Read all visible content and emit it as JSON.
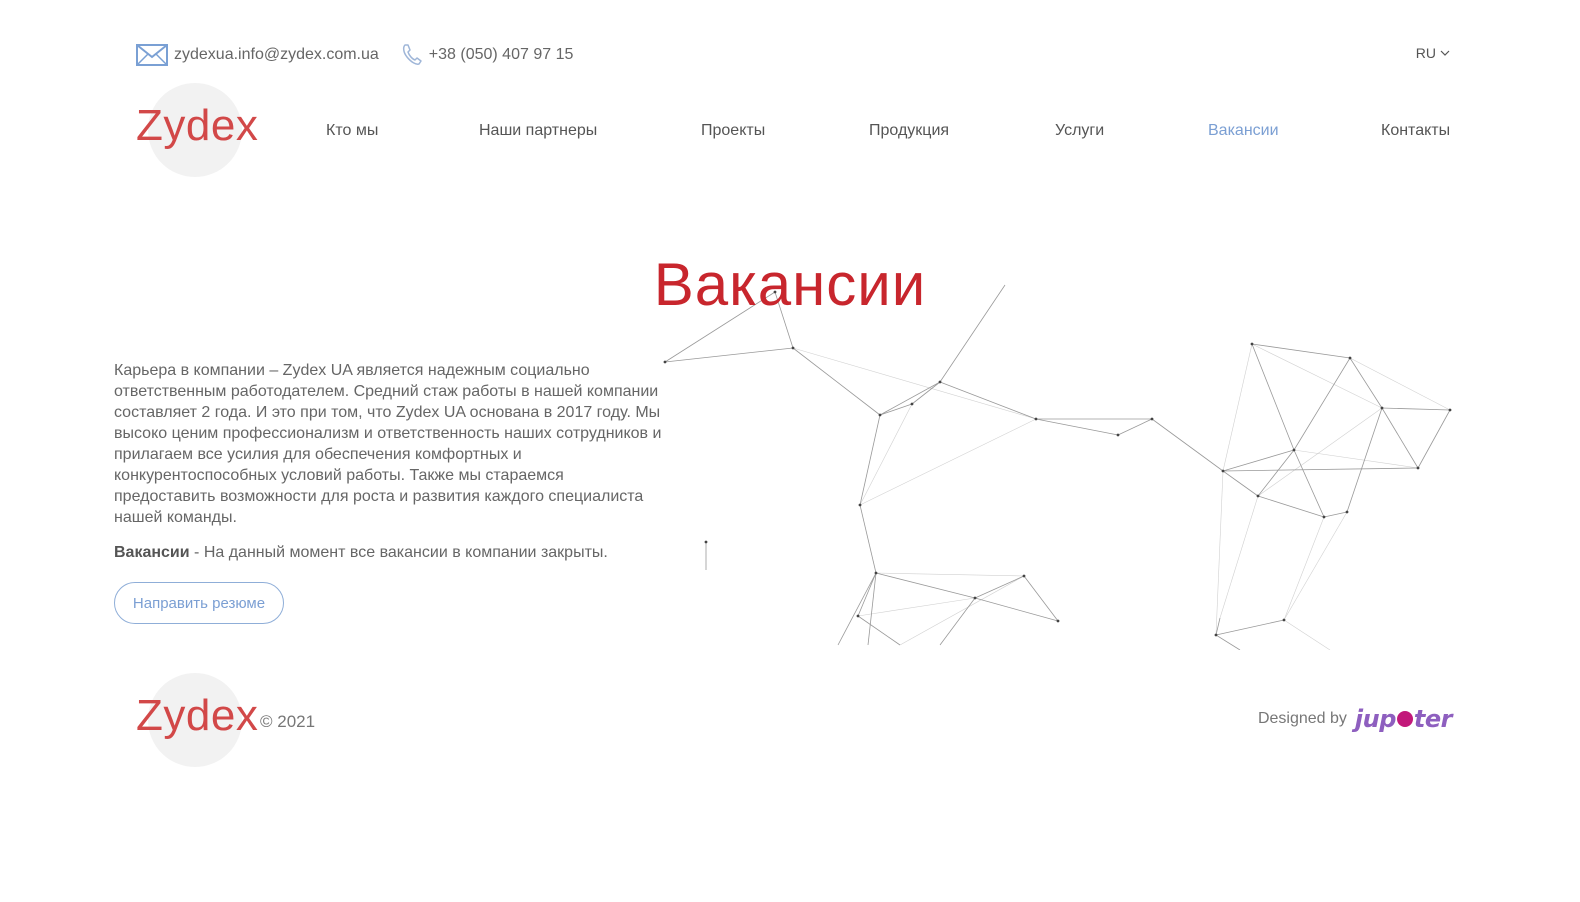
{
  "contacts": {
    "email": "zydexua.info@zydex.com.ua",
    "phone": "+38 (050) 407 97 15"
  },
  "language": {
    "current": "RU"
  },
  "logo": {
    "text": "Zydex"
  },
  "nav": {
    "items": [
      {
        "label": "Кто мы",
        "active": false
      },
      {
        "label": "Наши партнеры",
        "active": false
      },
      {
        "label": "Проекты",
        "active": false
      },
      {
        "label": "Продукция",
        "active": false
      },
      {
        "label": "Услуги",
        "active": false
      },
      {
        "label": "Вакансии",
        "active": true
      },
      {
        "label": "Контакты",
        "active": false
      }
    ]
  },
  "main": {
    "title": "Вакансии",
    "intro": "Карьера в компании – Zydex UA является надежным социально ответственным работодателем. Средний стаж работы в нашей компании составляет 2 года. И это при том, что Zydex UA основана в 2017 году. Мы высоко ценим профессионализм и ответственность наших сотрудников и прилагаем все усилия для обеспечения комфортных и конкурентоспособных условий работы. Также мы стараемся предоставить возможности для роста и развития каждого специалиста нашей команды.",
    "vacancies_label": "Вакансии",
    "vacancies_text": " - На данный момент все вакансии в компании закрыты.",
    "resume_button": "Направить резюме"
  },
  "footer": {
    "copyright": "© 2021",
    "designed_by": "Designed by",
    "designer_logo": {
      "part1": "jup",
      "part2": "ter"
    }
  },
  "colors": {
    "brand_red": "#c8262d",
    "logo_red": "#d24848",
    "accent_blue": "#7b9fd3",
    "text": "#666666",
    "designer_purple": "#8e5fbf",
    "designer_magenta": "#c2187a"
  }
}
